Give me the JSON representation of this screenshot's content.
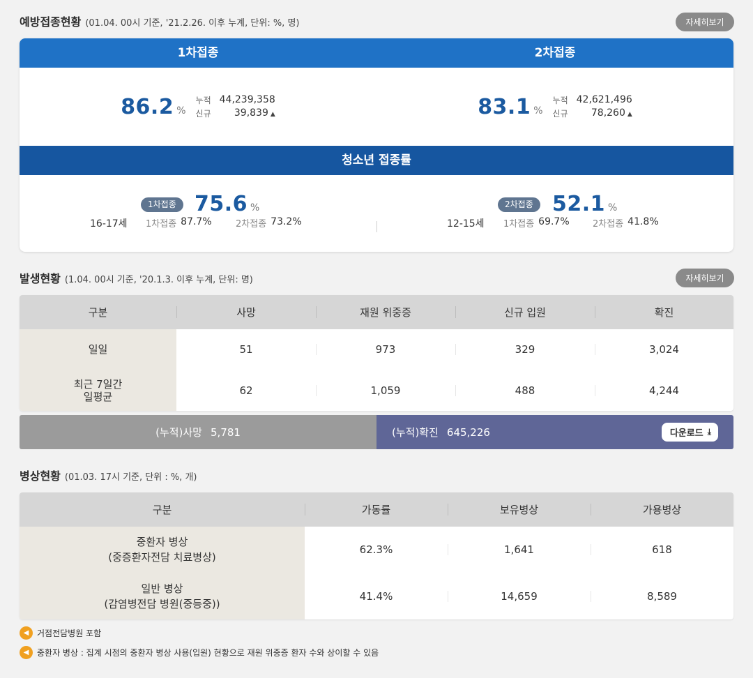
{
  "vaccination": {
    "title": "예방접종현황",
    "note": "(01.04. 00시 기준, '21.2.26. 이후 누계, 단위: %, 명)",
    "more_label": "자세히보기",
    "dose1": {
      "label": "1차접종",
      "rate": "86.2",
      "pct": "%",
      "cum_key": "누적",
      "cum_val": "44,239,358",
      "new_key": "신규",
      "new_val": "39,839"
    },
    "dose2": {
      "label": "2차접종",
      "rate": "83.1",
      "pct": "%",
      "cum_key": "누적",
      "cum_val": "42,621,496",
      "new_key": "신규",
      "new_val": "78,260"
    },
    "teen": {
      "title": "청소년 접종률",
      "left": {
        "age": "16-17세",
        "badge": "1차접종",
        "rate": "75.6",
        "pct": "%",
        "d1_key": "1차접종",
        "d1_val": "87.7%",
        "d2_key": "2차접종",
        "d2_val": "73.2%"
      },
      "right": {
        "age": "12-15세",
        "badge": "2차접종",
        "rate": "52.1",
        "pct": "%",
        "d1_key": "1차접종",
        "d1_val": "69.7%",
        "d2_key": "2차접종",
        "d2_val": "41.8%"
      }
    }
  },
  "occurrence": {
    "title": "발생현황",
    "note": "(1.04. 00시 기준, '20.1.3. 이후 누계, 단위: 명)",
    "more_label": "자세히보기",
    "headers": [
      "구분",
      "사망",
      "재원 위중증",
      "신규 입원",
      "확진"
    ],
    "rows": [
      {
        "label1": "일일",
        "label2": "",
        "values": [
          "51",
          "973",
          "329",
          "3,024"
        ]
      },
      {
        "label1": "최근 7일간",
        "label2": "일평균",
        "values": [
          "62",
          "1,059",
          "488",
          "4,244"
        ]
      }
    ],
    "cum_death_label": "(누적)사망",
    "cum_death_val": "5,781",
    "cum_conf_label": "(누적)확진",
    "cum_conf_val": "645,226",
    "download_label": "다운로드"
  },
  "beds": {
    "title": "병상현황",
    "note": "(01.03. 17시 기준, 단위 : %, 개)",
    "headers": [
      "구분",
      "가동률",
      "보유병상",
      "가용병상"
    ],
    "rows": [
      {
        "label1": "중환자 병상",
        "label2": "(중증환자전담 치료병상)",
        "values": [
          "62.3%",
          "1,641",
          "618"
        ]
      },
      {
        "label1": "일반 병상",
        "label2": "(감염병전담 병원(중등중))",
        "values": [
          "41.4%",
          "14,659",
          "8,589"
        ]
      }
    ]
  },
  "notes": [
    "거점전담병원 포함",
    "중환자 병상 : 집계 시점의 중환자 병상 사용(입원) 현황으로 재원 위중증 환자 수와 상이할 수 있음"
  ],
  "icons": {
    "note": "speaker-icon",
    "up": "triangle-up-icon",
    "download": "download-icon"
  },
  "colors": {
    "primary_blue": "#1f72c6",
    "dark_blue": "#1656a0",
    "number_blue": "#1b5aa0",
    "cum_gray": "#9b9b9b",
    "cum_purple": "#5f6697",
    "note_orange": "#f0a020"
  }
}
